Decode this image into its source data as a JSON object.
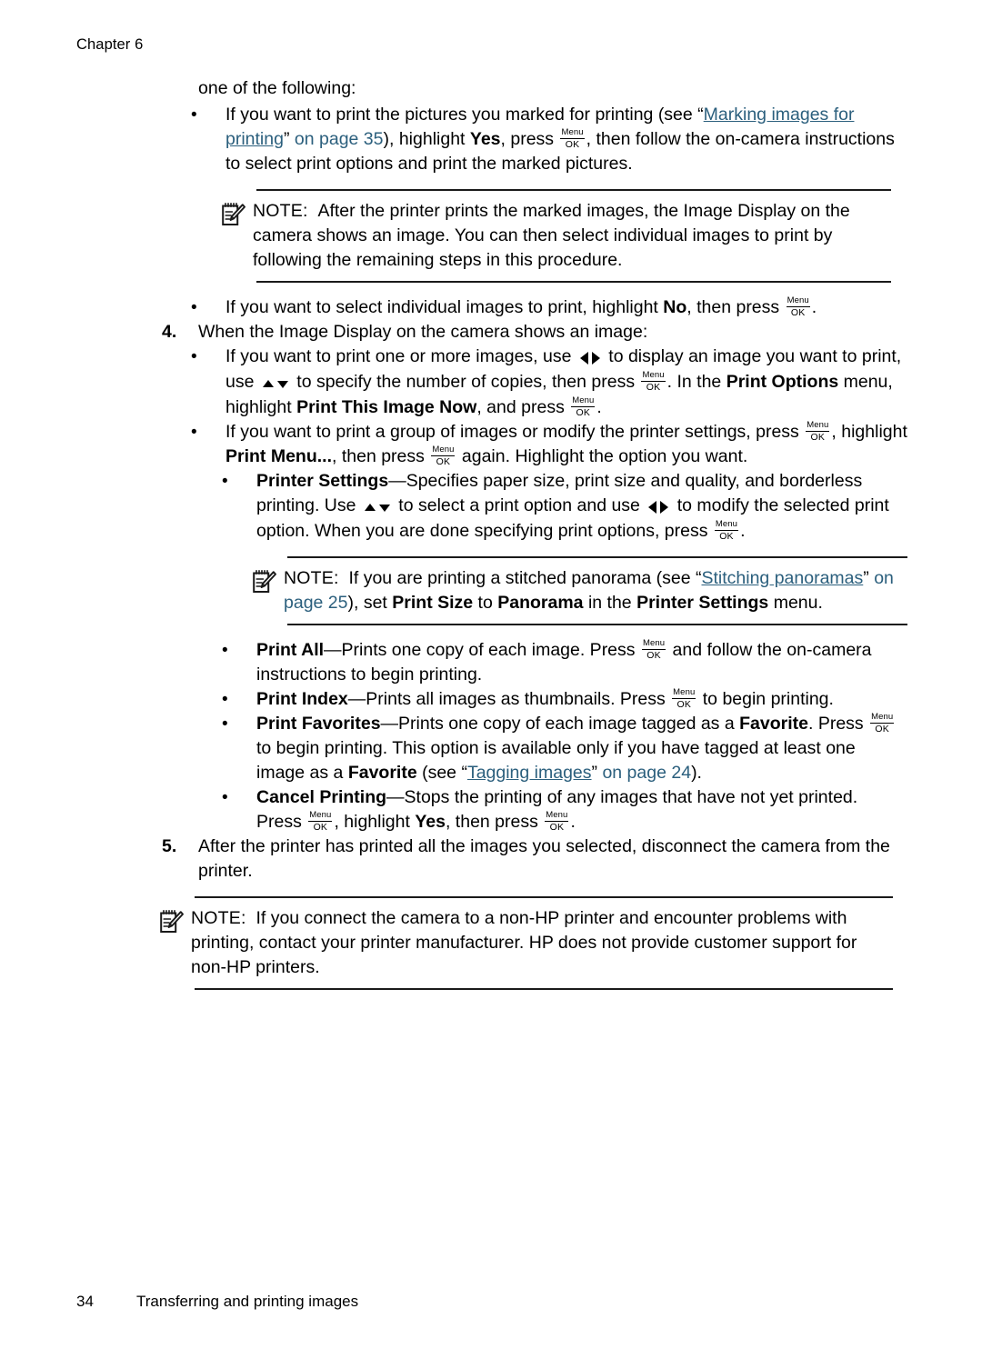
{
  "header": {
    "chapter": "Chapter 6"
  },
  "glyphs": {
    "menu_key_top": "Menu",
    "menu_key_bottom": "OK",
    "note_label": "NOTE:"
  },
  "intro": {
    "lead_in": "one of the following:"
  },
  "bullets_step3": [
    {
      "name": "print-marked-pictures",
      "segments": [
        {
          "t": "If you want to print the pictures you marked for printing (see “",
          "style": "plain"
        },
        {
          "t": "Marking images for printing",
          "style": "link"
        },
        {
          "t": "” ",
          "style": "plain"
        },
        {
          "t": "on page 35",
          "style": "linkplain"
        },
        {
          "t": "), highlight ",
          "style": "plain"
        },
        {
          "t": "Yes",
          "style": "bold"
        },
        {
          "t": ", press ",
          "style": "plain"
        },
        {
          "t": "",
          "style": "menukey"
        },
        {
          "t": ", then follow the on-camera instructions to select print options and print the marked pictures.",
          "style": "plain"
        }
      ]
    }
  ],
  "note_1": {
    "label": "NOTE:",
    "text": "After the printer prints the marked images, the Image Display on the camera shows an image. You can then select individual images to print by following the remaining steps in this procedure."
  },
  "bullet_select_individual": {
    "pre": "If you want to select individual images to print, highlight ",
    "bold": "No",
    "mid": ", then press ",
    "post": "."
  },
  "step_4": {
    "number": "4.",
    "text": "When the Image Display on the camera shows an image:"
  },
  "step4_bullet_1": {
    "s1": "If you want to print one or more images, use ",
    "s2": " to display an image you want to print, use ",
    "s3": " to specify the number of copies, then press ",
    "s4": ". In the ",
    "b1": "Print Options",
    "s5": " menu, highlight ",
    "b2": "Print This Image Now",
    "s6": ", and press ",
    "s7": "."
  },
  "step4_bullet_2": {
    "s1": "If you want to print a group of images or modify the printer settings, press ",
    "s2": ", highlight ",
    "b1": "Print Menu...",
    "s3": ", then press ",
    "s4": " again. Highlight the option you want.",
    "sub_bullets": [
      {
        "name": "printer-settings",
        "bold": "Printer Settings",
        "s1": "—Specifies paper size, print size and quality, and borderless printing. Use ",
        "s2": " to select a print option and use ",
        "s3": " to modify the selected print option. When you are done specifying print options, press ",
        "s4": "."
      }
    ]
  },
  "note_2": {
    "label": "NOTE:",
    "s1": "If you are printing a stitched panorama (see “",
    "link": "Stitching panoramas",
    "s2": "” ",
    "linkplain": "on page 25",
    "s3": "), set ",
    "b1": "Print Size",
    "s4": " to ",
    "b2": "Panorama",
    "s5": " in the ",
    "b3": "Printer Settings",
    "s6": " menu."
  },
  "print_options": [
    {
      "name": "print-all",
      "bold": "Print All",
      "s1": "—Prints one copy of each image. Press ",
      "s2": " and follow the on-camera instructions to begin printing."
    },
    {
      "name": "print-index",
      "bold": "Print Index",
      "s1": "—Prints all images as thumbnails. Press ",
      "s2": " to begin printing."
    }
  ],
  "print_favorites": {
    "bold": "Print Favorites",
    "s1": "—Prints one copy of each image tagged as a ",
    "b1": "Favorite",
    "s2": ". Press ",
    "s3": " to begin printing. This option is available only if you have tagged at least one image as a ",
    "b2": "Favorite",
    "s4": " (see “",
    "link": "Tagging images",
    "s5": "” ",
    "linkplain": "on page 24",
    "s6": ")."
  },
  "cancel_printing": {
    "bold": "Cancel Printing",
    "s1": "—Stops the printing of any images that have not yet printed. Press ",
    "s2": ", highlight ",
    "b1": "Yes",
    "s3": ", then press ",
    "s4": "."
  },
  "step_5": {
    "number": "5.",
    "text": "After the printer has printed all the images you selected, disconnect the camera from the printer."
  },
  "note_3": {
    "label": "NOTE:",
    "text": "If you connect the camera to a non-HP printer and encounter problems with printing, contact your printer manufacturer. HP does not provide customer support for non-HP printers."
  },
  "footer": {
    "page_number": "34",
    "title": "Transferring and printing images"
  },
  "colors": {
    "link": "#2b5f7d",
    "text": "#000000",
    "rule": "#1a1a1a"
  }
}
